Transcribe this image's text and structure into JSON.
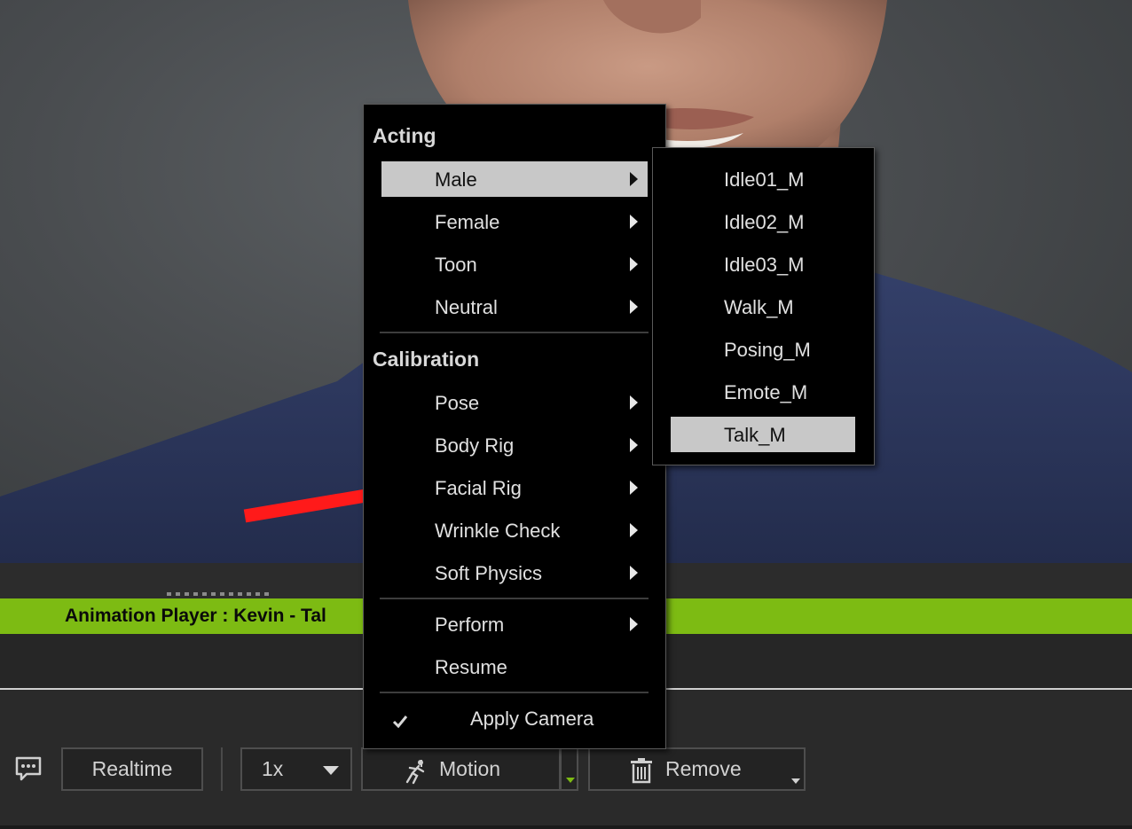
{
  "context_menu": {
    "sections": [
      {
        "header": "Acting",
        "items": [
          "Male",
          "Female",
          "Toon",
          "Neutral"
        ]
      },
      {
        "header": "Calibration",
        "items": [
          "Pose",
          "Body Rig",
          "Facial Rig",
          "Wrinkle Check",
          "Soft Physics"
        ]
      }
    ],
    "extra_items": [
      "Perform",
      "Resume"
    ],
    "apply_camera_label": "Apply Camera",
    "apply_camera_checked": true,
    "highlighted_item": "Male"
  },
  "submenu": {
    "items": [
      "Idle01_M",
      "Idle02_M",
      "Idle03_M",
      "Walk_M",
      "Posing_M",
      "Emote_M",
      "Talk_M"
    ],
    "highlighted_item": "Talk_M"
  },
  "panel": {
    "title": "Animation Player : Kevin - Tal"
  },
  "toolbar": {
    "realtime_label": "Realtime",
    "speed_value": "1x",
    "motion_label": "Motion",
    "remove_label": "Remove"
  },
  "colors": {
    "accent_green": "#7dbb13",
    "annotation_arrow": "#ff1a1a",
    "menu_highlight": "#c8c8c8"
  }
}
